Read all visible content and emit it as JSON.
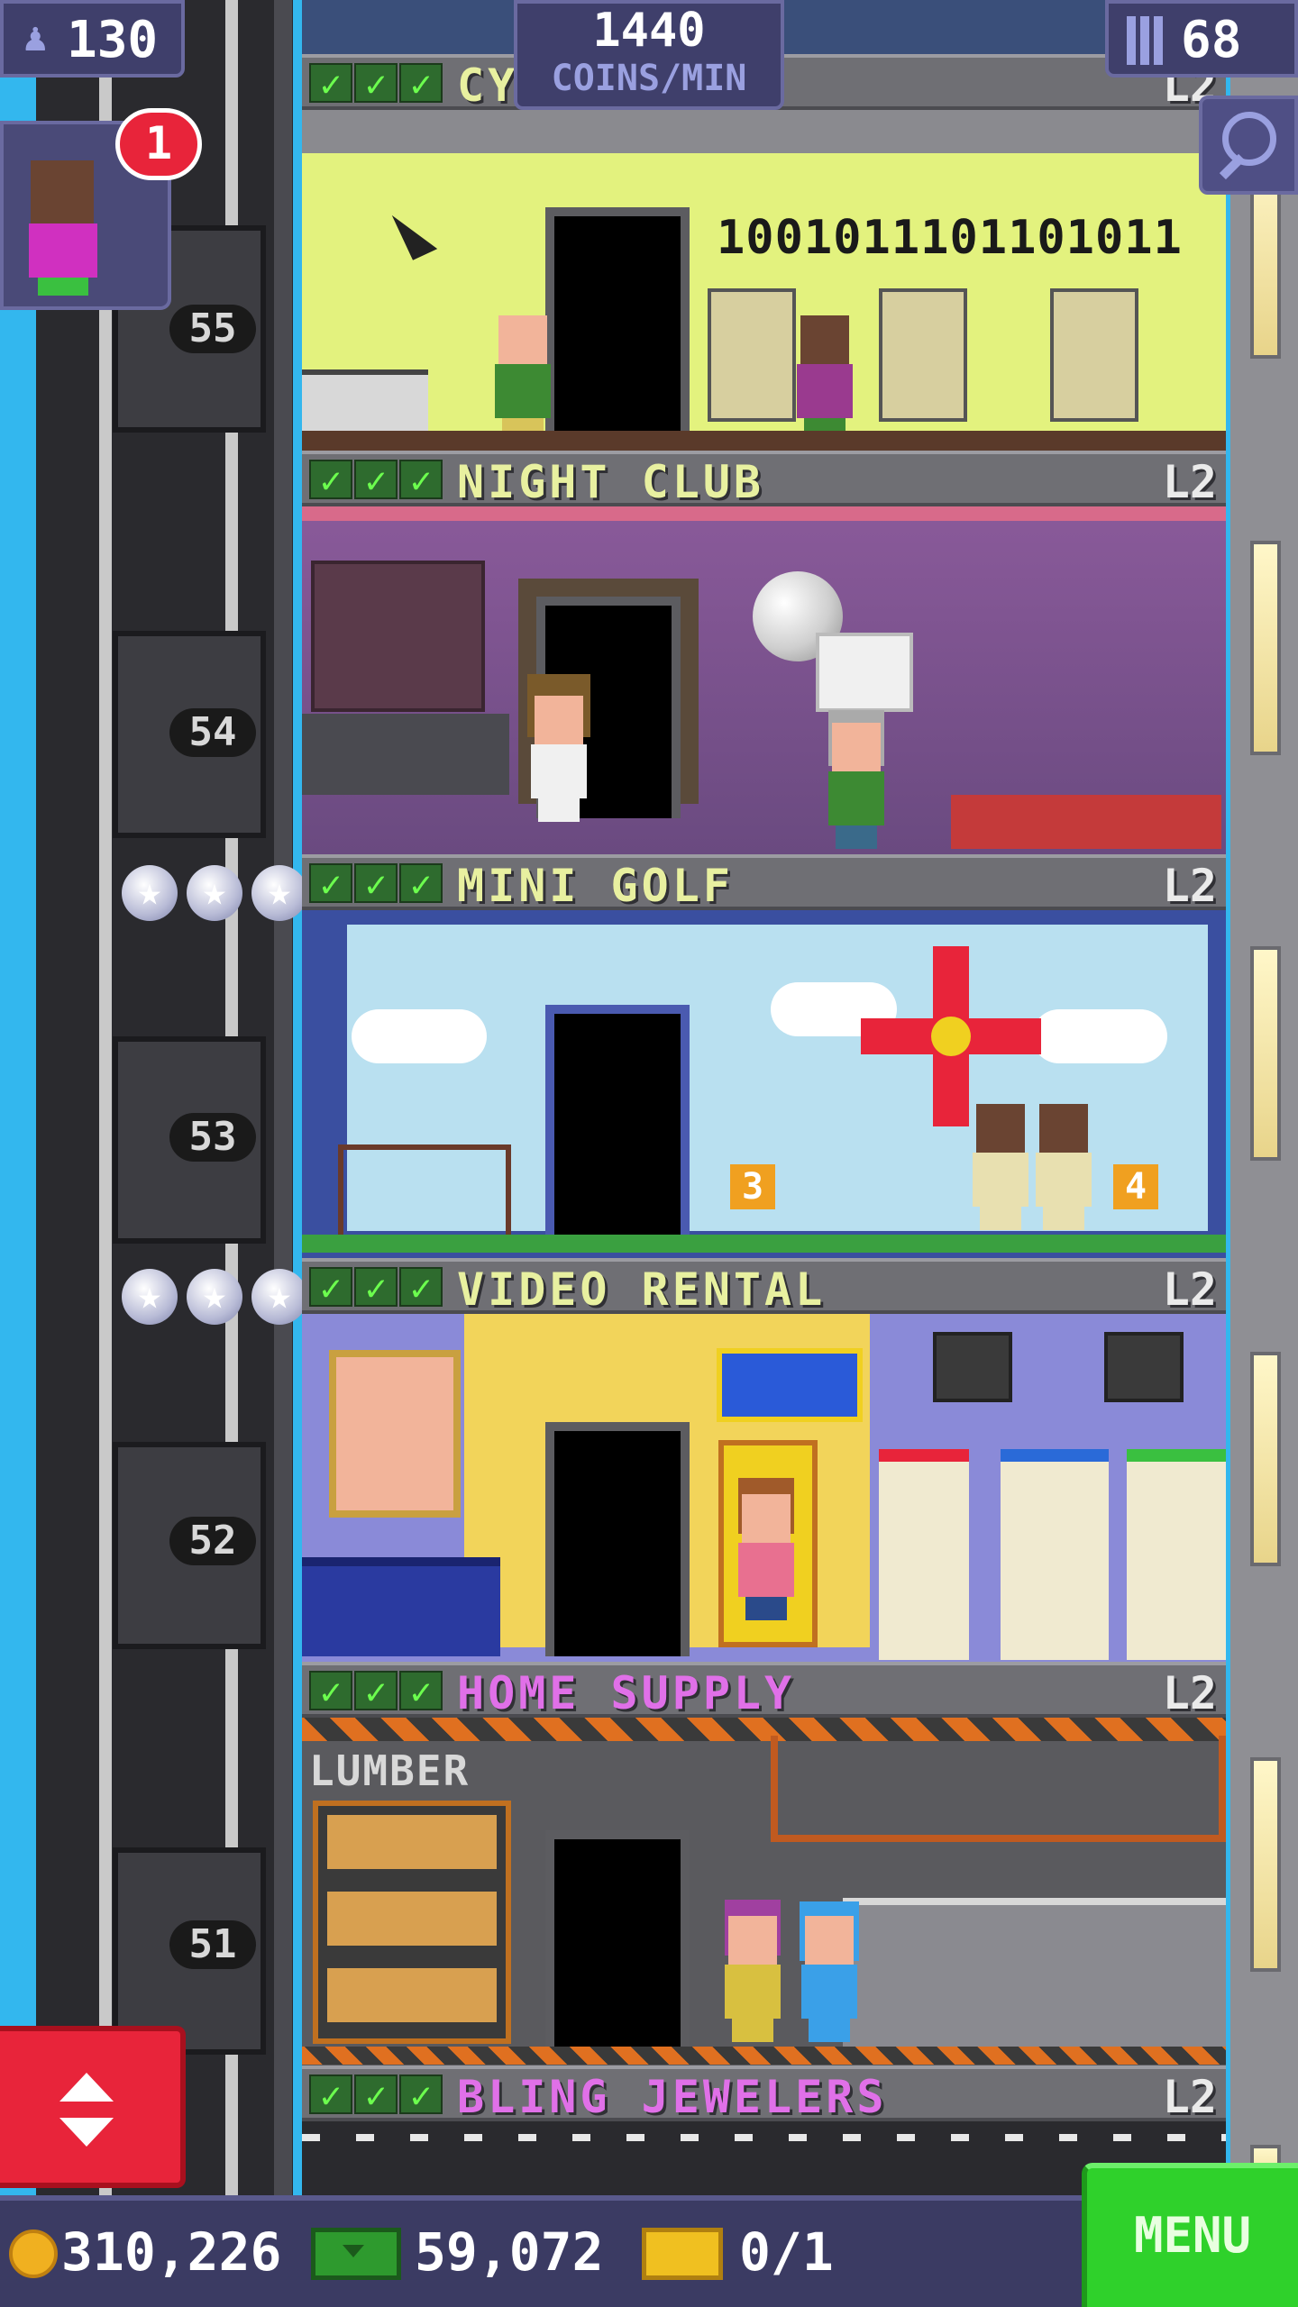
{
  "hud": {
    "residents": "130",
    "coins_per_min_value": "1440",
    "coins_per_min_label": "COINS/MIN",
    "floors": "68",
    "notification_count": "1"
  },
  "top_floor_partial": {
    "name": "CY",
    "level": "L2",
    "binary_display": "1001011101101011"
  },
  "floor_numbers": [
    "55",
    "54",
    "53",
    "52",
    "51"
  ],
  "floors": [
    {
      "name": "NIGHT CLUB",
      "level": "L2",
      "name_color": "#e8f0a0"
    },
    {
      "name": "MINI GOLF",
      "level": "L2",
      "name_color": "#e8f0a0"
    },
    {
      "name": "VIDEO RENTAL",
      "level": "L2",
      "name_color": "#e8f0a0"
    },
    {
      "name": "HOME SUPPLY",
      "level": "L2",
      "name_color": "#e070e8"
    },
    {
      "name": "BLING JEWELERS",
      "level": "L2",
      "name_color": "#e070e8"
    }
  ],
  "room_signs": {
    "mini_golf_hole_a": "3",
    "mini_golf_hole_b": "4",
    "home_supply_sign": "LUMBER"
  },
  "bottom": {
    "coins": "310,226",
    "bux": "59,072",
    "tickets": "0/1",
    "menu_label": "MENU"
  },
  "icons": {
    "residents": "person-icon",
    "floors": "building-icon",
    "search": "magnifier-icon",
    "elevator": "up-down-arrows-icon",
    "coin": "coin-icon",
    "bux": "cash-icon",
    "ticket": "ticket-icon",
    "check": "check-icon",
    "star": "star-icon"
  },
  "colors": {
    "menu_green": "#2fd12b",
    "elevator_button_red": "#e8243a",
    "hud_panel": "#3f3f6b",
    "sky": "#33b7ee"
  }
}
